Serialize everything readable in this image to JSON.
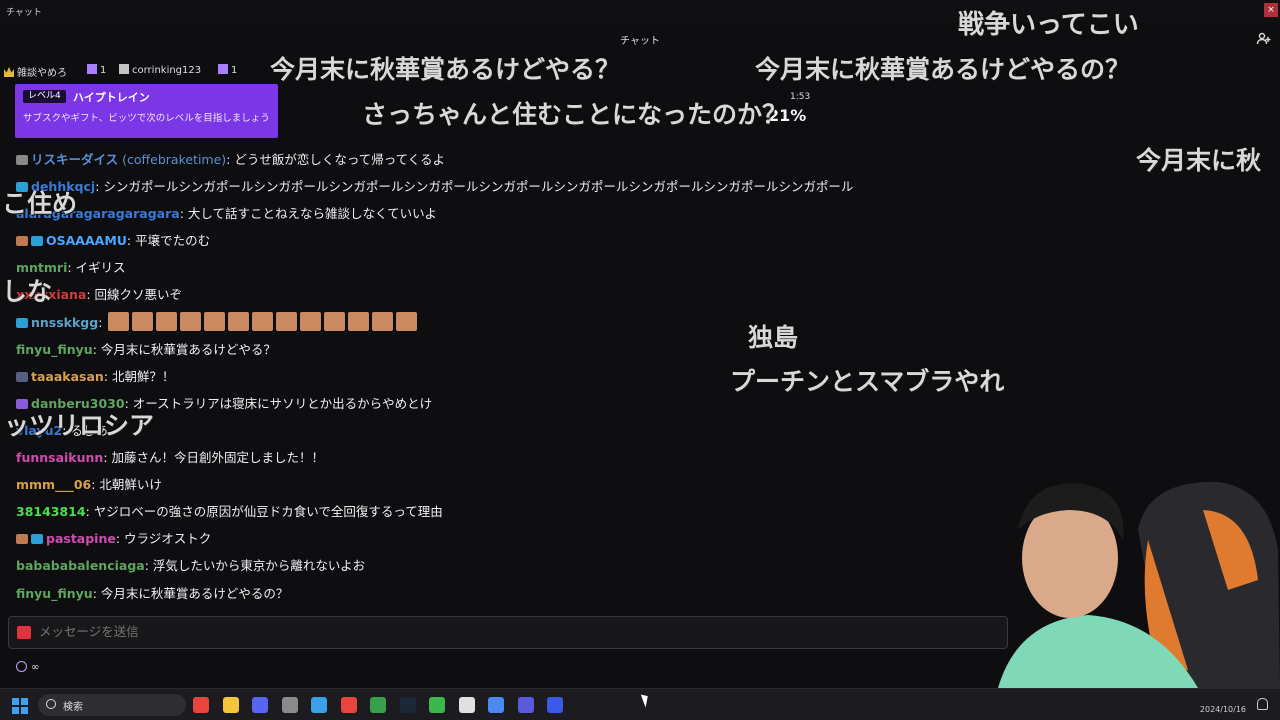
{
  "window": {
    "title": "チャット"
  },
  "header": {
    "title": "チャット"
  },
  "gifters": [
    {
      "name": "雑談やめろ",
      "count": "1"
    },
    {
      "name": "corrinking123",
      "count": "1"
    }
  ],
  "hype_train": {
    "level": "レベル4",
    "title": "ハイプトレイン",
    "description": "サブスクやギフト、ビッツで次のレベルを目指しましょう",
    "time": "1:53",
    "percent": "21%"
  },
  "messages": [
    {
      "user": "リスキーダイス",
      "display_extra": "(coffebraketime)",
      "text": ": どうせ飯が恋しくなって帰ってくるよ",
      "color": "#5b8fd6",
      "badge": "#888888"
    },
    {
      "user": "dehhkqcj",
      "text": ": シンガポールシンガポールシンガポールシンガポールシンガポールシンガポールシンガポールシンガポールシンガポールシンガポール",
      "color": "#3a7bd5",
      "badge": "#2a9fd8"
    },
    {
      "user": "alaragaragaragaragara",
      "text": ": 大して話すことねえなら雑談しなくていいよ",
      "color": "#3a7bd5"
    },
    {
      "user": "OSAAAAMU",
      "text": ": 平壌でたのむ",
      "color": "#4aa7ff",
      "badge": "#c07a50",
      "badge2": "#2a9fd8"
    },
    {
      "user": "mntmri",
      "text": ": イギリス",
      "color": "#5fa45f"
    },
    {
      "user": "xxxxxiana",
      "text": ": 回線クソ悪いぞ",
      "color": "#d23c3c"
    },
    {
      "user": "nnsskkgg",
      "text": ":",
      "color": "#5fa0c8",
      "badge": "#2a9fd8",
      "emotes": 13
    },
    {
      "user": "finyu_finyu",
      "text": ": 今月末に秋華賞あるけどやる？",
      "color": "#5fa45f"
    },
    {
      "user": "taaakasan",
      "text": ": 北朝鮮？！",
      "color": "#d8a04a",
      "badge": "#556080"
    },
    {
      "user": "danberu3030",
      "text": ": オーストラリアは寝床にサソリとか出るからやめとけ",
      "color": "#5fa45f",
      "badge": "#8a5ad8"
    },
    {
      "user": "vlayu2",
      "text": ": るしあ",
      "color": "#3a7bd5"
    },
    {
      "user": "funnsaikunn",
      "text": ": 加藤さん！今日創外固定しました！！",
      "color": "#d04bb0"
    },
    {
      "user": "mmm___06",
      "text": ": 北朝鮮いけ",
      "color": "#d8a04a"
    },
    {
      "user": "38143814",
      "text": ": ヤジロベーの強さの原因が仙豆ドカ食いで全回復するって理由",
      "color": "#4ade4a"
    },
    {
      "user": "pastapine",
      "text": ": ウラジオストク",
      "color": "#d04bb0",
      "badge": "#c07a50",
      "badge2": "#2a9fd8"
    },
    {
      "user": "babababalenciaga",
      "text": ": 浮気したいから東京から離れないよお",
      "color": "#5fa45f"
    },
    {
      "user": "finyu_finyu",
      "text": ": 今月末に秋華賞あるけどやるの？",
      "color": "#5fa45f"
    }
  ],
  "input": {
    "placeholder": "メッセージを送信"
  },
  "points": {
    "value": "∞"
  },
  "overlay_comments": [
    "戦争いってこい",
    "今月末に秋華賞あるけどやる？",
    "今月末に秋華賞あるけどやるの？",
    "さっちゃんと住むことになったのか？",
    "今月末に秋",
    "こ住め",
    "しな",
    "独島",
    "プーチンとスマブラやれ",
    "ッツリロシア"
  ],
  "taskbar": {
    "search_label": "検索",
    "clock": "2024/10/16",
    "apps": [
      "chrome-icon",
      "folder-icon",
      "discord-icon",
      "obs-icon",
      "notepad-icon",
      "chrome-icon",
      "xbox-icon",
      "steam-icon",
      "play-icon",
      "x-icon",
      "drive-icon",
      "app-icon",
      "screen-icon"
    ],
    "app_colors": [
      "#e8453c",
      "#f2c53d",
      "#5865f2",
      "#8a8a8a",
      "#3aa0e8",
      "#e8453c",
      "#36a04a",
      "#1b2838",
      "#3cb84a",
      "#e0e0e0",
      "#4a8af0",
      "#5a5adf",
      "#3a5ae8"
    ]
  }
}
